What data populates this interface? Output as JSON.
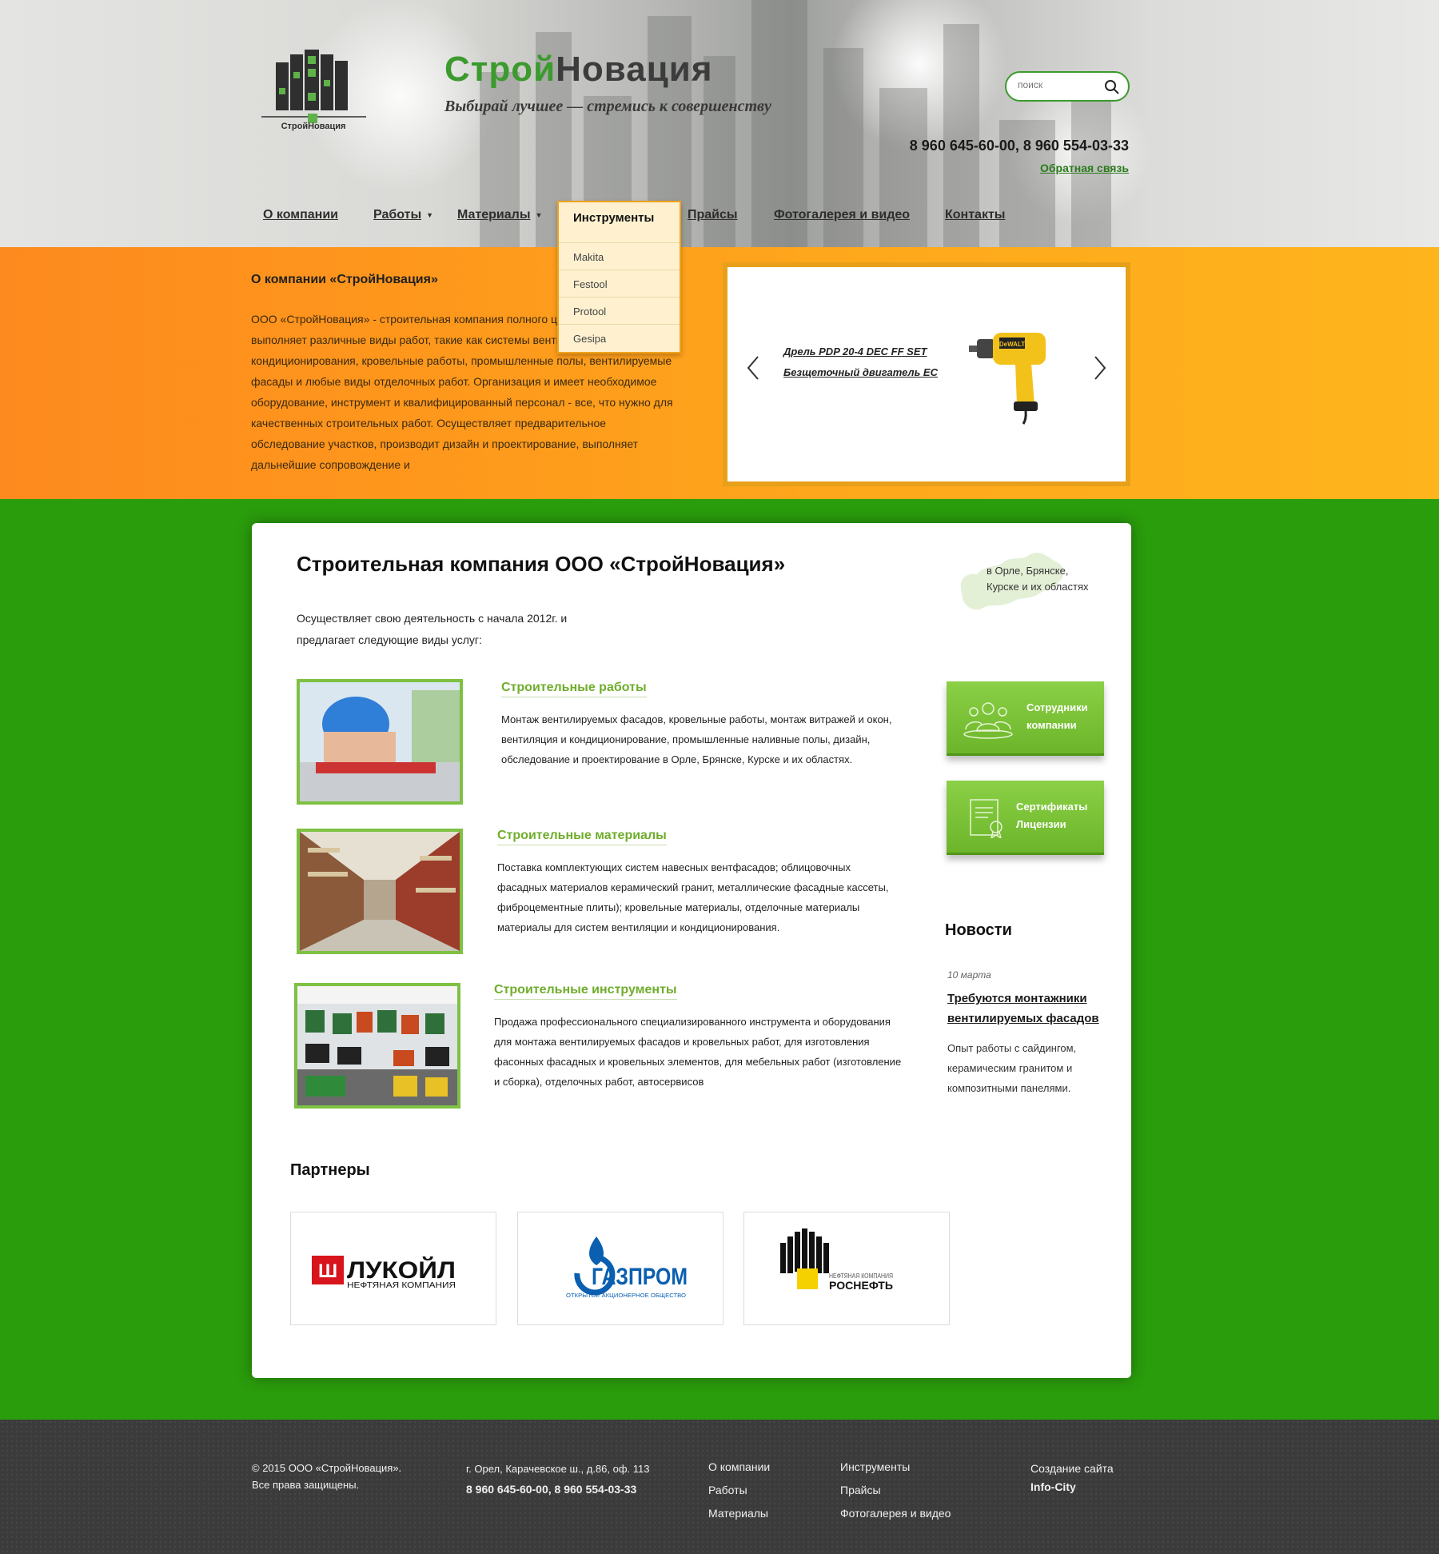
{
  "header": {
    "logo_text": "СтройНовация",
    "brand_part1": "Строй",
    "brand_part2": "Новация",
    "slogan": "Выбирай лучшее — стремись к совершенству",
    "search_placeholder": "поиск",
    "phones": "8 960 645-60-00, 8 960 554-03-33",
    "callback": "Обратная связь"
  },
  "nav": {
    "items": [
      {
        "label": "О компании"
      },
      {
        "label": "Работы"
      },
      {
        "label": "Материалы"
      },
      {
        "label": "Инструменты"
      },
      {
        "label": "Прайсы"
      },
      {
        "label": "Фотогалерея и видео"
      },
      {
        "label": "Контакты"
      }
    ],
    "dropdown": {
      "title": "Инструменты",
      "options": [
        "Makita",
        "Festool",
        "Protool",
        "Gesipa"
      ]
    }
  },
  "about": {
    "title": "О компании «СтройНовация»",
    "text": "ООО «СтройНовация» - строительная компания полного цикла, которая выполняет различные виды работ, такие как системы вентиляции и кондиционирования, кровельные работы, промышленные полы, вентилируемые фасады и любые виды отделочных работ. Организация и имеет необходимое оборудование, инструмент и квалифицированный персонал - все, что нужно для качественных строительных работ. Осуществляет предварительное обследование участков, производит дизайн и проектирование, выполняет дальнейшие сопровождение и"
  },
  "slider": {
    "caption_line1": "Дрель PDP 20-4 DEC FF SET",
    "caption_line2": "Безщеточный двигатель EC",
    "drill_brand": "DeWALT"
  },
  "main": {
    "title": "Строительная компания ООО «СтройНовация»",
    "intro_line1": "Осуществляет свою деятельность с начала 2012г. и",
    "intro_line2": "предлагает следующие виды услуг:",
    "regions_line1": "в Орле, Брянске,",
    "regions_line2": "Курске и их областях",
    "services": [
      {
        "title": "Строительные работы",
        "desc": "Монтаж вентилируемых фасадов, кровельные работы, монтаж витражей и окон, вентиляция и кондиционирование, промышленные наливные полы, дизайн, обследование и проектирование в Орле, Брянске, Курске и их областях."
      },
      {
        "title": "Строительные материалы",
        "desc": "Поставка комплектующих систем навесных вентфасадов; облицовочных фасадных материалов керамический гранит, металлические фасадные кассеты, фиброцементные плиты); кровельные материалы, отделочные материалы материалы для систем вентиляции и кондиционирования."
      },
      {
        "title": "Строительные инструменты",
        "desc": "Продажа профессионального специализированного инструмента и оборудования для монтажа вентилируемых фасадов и кровельных работ, для изготовления фасонных фасадных и кровельных элементов, для мебельных работ (изготовление и сборка), отделочных работ, автосервисов"
      }
    ],
    "buttons": [
      {
        "line1": "Сотрудники",
        "line2": "компании"
      },
      {
        "line1": "Сертификаты",
        "line2": "Лицензии"
      }
    ],
    "news": {
      "title": "Новости",
      "date": "10 марта",
      "headline": "Требуются монтажники вентилируемых фасадов",
      "body": "Опыт работы с сайдингом, керамическим гранитом и композитными панелями."
    },
    "partners": {
      "title": "Партнеры",
      "lukoil_name": "ЛУКОЙЛ",
      "lukoil_sub": "НЕФТЯНАЯ КОМПАНИЯ",
      "gazprom_name": "ГАЗПРОМ",
      "gazprom_sub": "ОТКРЫТОЕ АКЦИОНЕРНОЕ ОБЩЕСТВО",
      "rosneft_name": "РОСНЕФТЬ",
      "rosneft_sub": "НЕФТЯНАЯ КОМПАНИЯ"
    }
  },
  "footer": {
    "copyright_line1": "© 2015 ООО «СтройНовация».",
    "copyright_line2": "Все права защищены.",
    "address": "г. Орел, Карачевское ш., д.86, оф. 113",
    "phones": "8 960 645-60-00, 8 960 554-03-33",
    "links_col1": [
      "О компании",
      "Работы",
      "Материалы"
    ],
    "links_col2": [
      "Инструменты",
      "Прайсы",
      "Фотогалерея и видео"
    ],
    "credit_line1": "Создание сайта",
    "credit_line2": "Info-City"
  },
  "colors": {
    "green_bg": "#2a9d0c",
    "accent_green": "#6fad2c",
    "orange": "#fea81c",
    "footer_bg": "#3b3b3b"
  }
}
